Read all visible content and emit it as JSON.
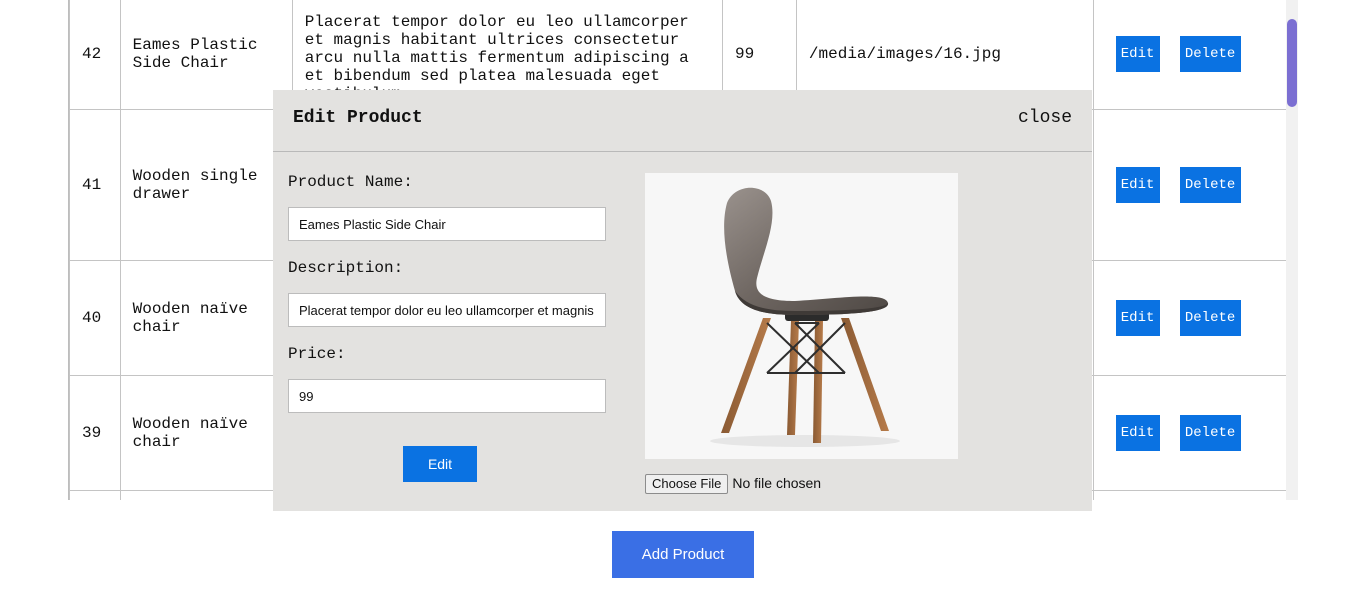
{
  "table": {
    "rows": [
      {
        "id": "42",
        "name_line1": "Eames Plastic",
        "name_line2": "Side Chair",
        "description": "Placerat tempor dolor eu leo ullamcorper et magnis habitant ultrices consectetur arcu nulla mattis fermentum adipiscing a et bibendum sed platea malesuada eget vestibulum.",
        "price": "99",
        "image": "/media/images/16.jpg",
        "edit": "Edit",
        "delete": "Delete"
      },
      {
        "id": "41",
        "name_line1": "Wooden single",
        "name_line2": "drawer",
        "edit": "Edit",
        "delete": "Delete"
      },
      {
        "id": "40",
        "name_line1": "Wooden naïve",
        "name_line2": "chair",
        "edit": "Edit",
        "delete": "Delete"
      },
      {
        "id": "39",
        "name_line1": "Wooden naïve",
        "name_line2": "chair",
        "edit": "Edit",
        "delete": "Delete"
      }
    ]
  },
  "modal": {
    "title": "Edit Product",
    "close": "close",
    "name_label": "Product Name:",
    "name_value": "Eames Plastic Side Chair",
    "description_label": "Description:",
    "description_value": "Placerat tempor dolor eu leo ullamcorper et magnis",
    "price_label": "Price:",
    "price_value": "99",
    "edit_button": "Edit",
    "choose_file": "Choose File",
    "no_file": "No file chosen",
    "image_icon": "chair-photo"
  },
  "add_product": "Add Product",
  "colors": {
    "primary": "#0a72e2",
    "add_button": "#3a6fe5",
    "modal_bg": "#e3e2e0",
    "scroll_thumb": "#7b6fd2"
  }
}
